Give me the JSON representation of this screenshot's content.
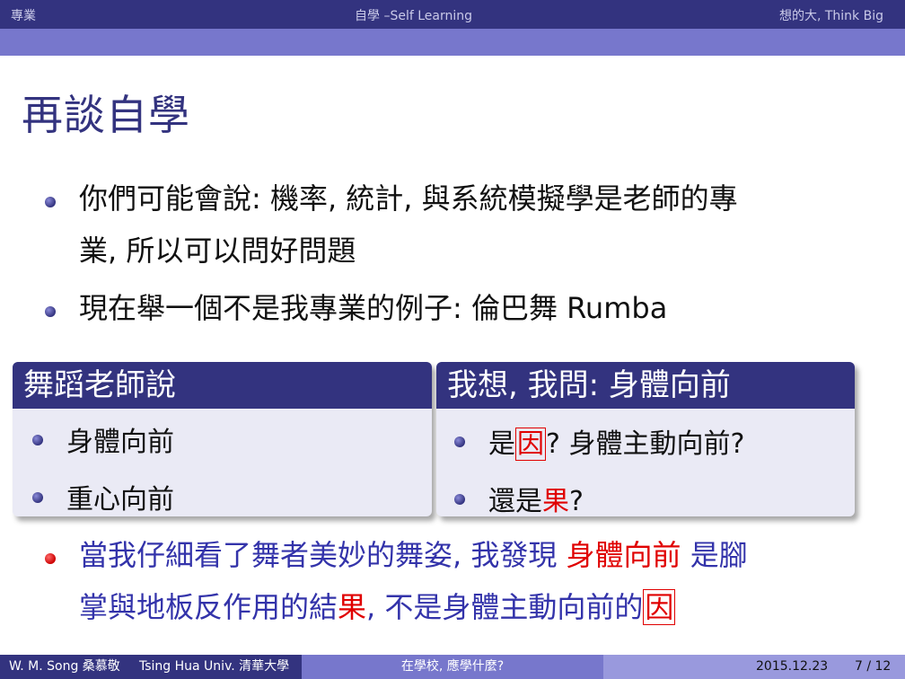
{
  "header": {
    "left": "專業",
    "center": "自學 –Self Learning",
    "right": "想的大, Think Big"
  },
  "slide": {
    "title": "再談自學",
    "bullets": [
      {
        "line1": "你們可能會說: 機率, 統計, 與系統模擬學是老師的專",
        "line2": "業, 所以可以問好問題"
      },
      {
        "line1": "現在舉一個不是我專業的例子: 倫巴舞 Rumba"
      }
    ],
    "left_block": {
      "title": "舞蹈老師說",
      "items": [
        "身體向前",
        "重心向前"
      ]
    },
    "right_block": {
      "title": "我想, 我問: 身體向前",
      "item1": {
        "a": "是",
        "b": "因",
        "c": "? 身體主動向前?"
      },
      "item2": {
        "a": "還是",
        "b": "果",
        "c": "?"
      }
    },
    "conclusion": {
      "l1_a": "當我仔細看了舞者美妙的舞姿, 我發現 ",
      "l1_b": "身體向前",
      "l1_c": " 是腳",
      "l2_a": "掌與地板反作用的結",
      "l2_b": "果",
      "l2_c": ", 不是身體主動向前的",
      "l2_d": "因"
    }
  },
  "footer": {
    "author": "W. M. Song 桑慕敬",
    "institute": "Tsing Hua Univ. 清華大學",
    "talk": "在學校, 應學什麼?",
    "date": "2015.12.23",
    "page": "7 / 12"
  },
  "colors": {
    "dark_blue": "#33337f",
    "mid_blue": "#7777cc",
    "light_blue": "#9999dd",
    "block_body": "#eaeaf5",
    "alert_red": "#e00000",
    "text_blue": "#3333aa"
  }
}
